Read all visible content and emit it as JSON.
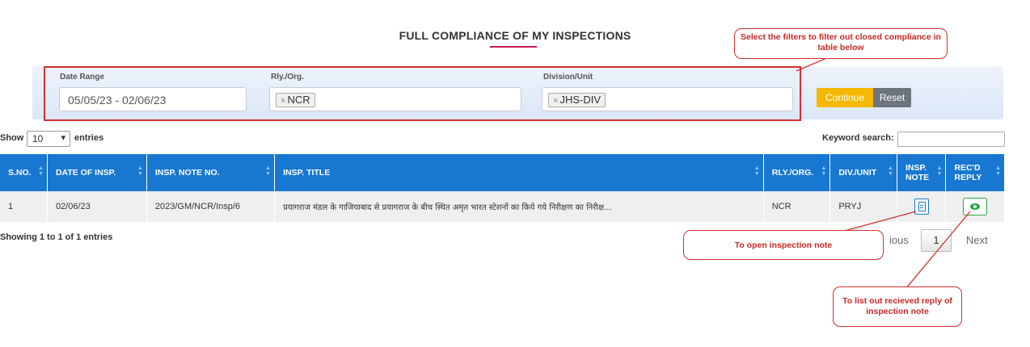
{
  "page": {
    "title": "FULL COMPLIANCE OF MY INSPECTIONS"
  },
  "filters": {
    "date_range": {
      "label": "Date Range",
      "value": "05/05/23 - 02/06/23"
    },
    "rly_org": {
      "label": "Rly./Org.",
      "chip": "NCR"
    },
    "division": {
      "label": "Division/Unit",
      "chip": "JHS-DIV"
    },
    "continue_label": "Continue",
    "reset_label": "Reset"
  },
  "table_controls": {
    "show_label": "Show",
    "entries_value": "10",
    "entries_label": "entries",
    "keyword_label": "Keyword search:"
  },
  "table": {
    "headers": [
      "S.NO.",
      "DATE OF INSP.",
      "INSP. NOTE NO.",
      "INSP. TITLE",
      "RLY./ORG.",
      "DIV./UNIT",
      "INSP. NOTE",
      "REC'D REPLY"
    ],
    "rows": [
      [
        "1",
        "02/06/23",
        "2023/GM/NCR/Insp/6",
        "प्रयागराज मंडल के गाजियाबाद से प्रयागराज के बीच स्थित अमृत भारत स्टेशनों का किये गये निरीक्षण का निरीक्ष...",
        "NCR",
        "PRYJ"
      ]
    ]
  },
  "footer": {
    "showing": "Showing 1 to 1 of 1 entries",
    "previous_partial": "ious",
    "current_page": "1",
    "next": "Next"
  },
  "callouts": {
    "filters": "Select the filters to filter out closed compliance in table below",
    "open_note": "To open inspection note",
    "list_reply": "To list out recieved reply of inspection note"
  },
  "colors": {
    "header_blue": "#1777d1",
    "accent_red": "#d32f2f",
    "continue_yellow": "#f6b800",
    "reset_gray": "#6c757d",
    "eye_green": "#28a745"
  }
}
